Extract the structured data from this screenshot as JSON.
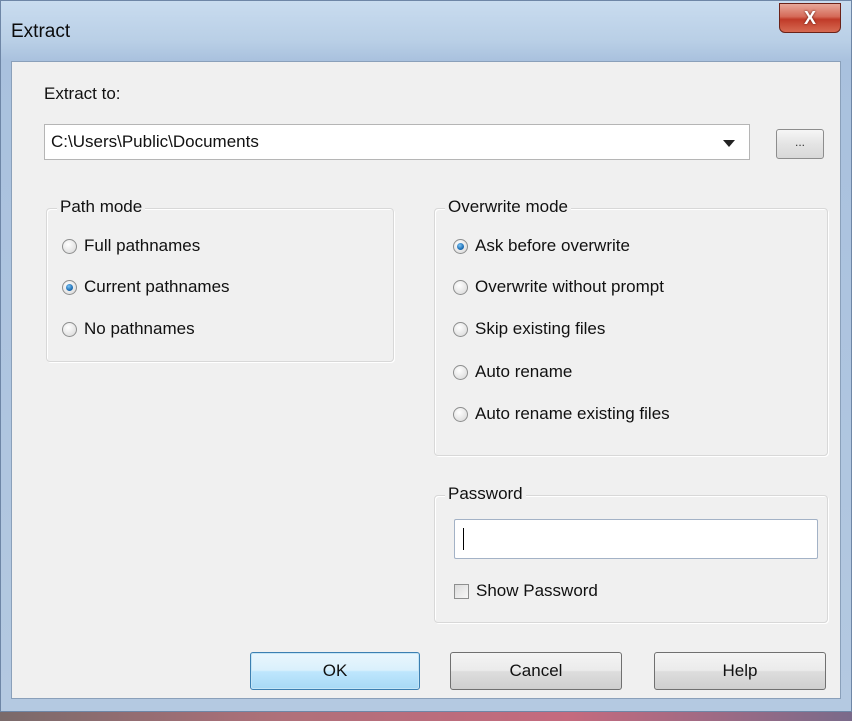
{
  "window": {
    "title": "Extract",
    "close_glyph": "X"
  },
  "extract_to": {
    "label": "Extract to:",
    "value": "C:\\Users\\Public\\Documents",
    "browse_label": "..."
  },
  "path_mode": {
    "title": "Path mode",
    "options": [
      {
        "label": "Full pathnames",
        "selected": false
      },
      {
        "label": "Current pathnames",
        "selected": true
      },
      {
        "label": "No pathnames",
        "selected": false
      }
    ]
  },
  "overwrite_mode": {
    "title": "Overwrite mode",
    "options": [
      {
        "label": "Ask before overwrite",
        "selected": true
      },
      {
        "label": "Overwrite without prompt",
        "selected": false
      },
      {
        "label": "Skip existing files",
        "selected": false
      },
      {
        "label": "Auto rename",
        "selected": false
      },
      {
        "label": "Auto rename existing files",
        "selected": false
      }
    ]
  },
  "password": {
    "title": "Password",
    "value": "",
    "show_password_label": "Show Password",
    "show_password_checked": false
  },
  "buttons": {
    "ok": "OK",
    "cancel": "Cancel",
    "help": "Help"
  },
  "colors": {
    "close_button": "#c8402c",
    "default_button_border": "#3c7fb1",
    "radio_selected": "#1e6fb5"
  }
}
